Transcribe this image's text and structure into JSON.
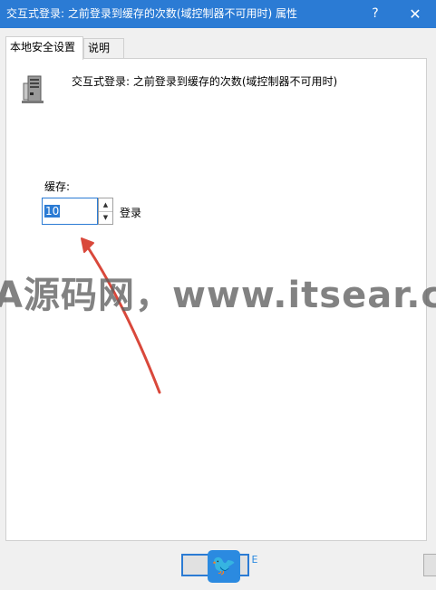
{
  "window": {
    "title": "交互式登录: 之前登录到缓存的次数(域控制器不可用时) 属性",
    "help_label": "?",
    "close_label": "✕"
  },
  "tabs": [
    {
      "label": "本地安全设置"
    },
    {
      "label": "说明"
    }
  ],
  "policy": {
    "title": "交互式登录: 之前登录到缓存的次数(域控制器不可用时)",
    "icon": "server-policy-icon"
  },
  "cache": {
    "label": "缓存:",
    "value": "10",
    "unit": "登录",
    "up_arrow": "▲",
    "down_arrow": "▼"
  },
  "watermark": {
    "text": "A源码网，www.itsear.co"
  },
  "colors": {
    "titlebar": "#2b7bd4",
    "arrow": "#d9483b",
    "selection": "#2b7bd4"
  },
  "overlay": {
    "bird_icon": "twitter-bird-icon",
    "bird_glyph": "🐦",
    "tag_text": "E"
  }
}
